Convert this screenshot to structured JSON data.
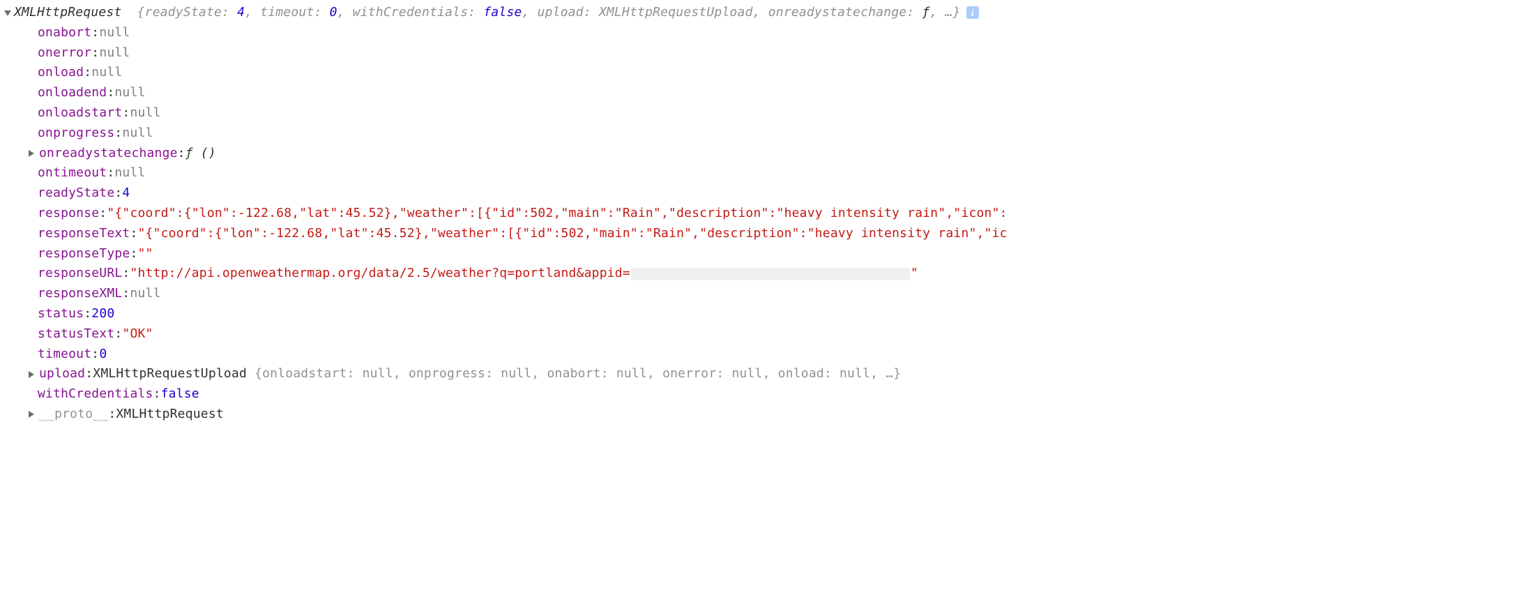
{
  "header": {
    "objectName": "XMLHttpRequest",
    "summaryParts": {
      "readyState_k": "readyState",
      "readyState_v": "4",
      "timeout_k": "timeout",
      "timeout_v": "0",
      "withCredentials_k": "withCredentials",
      "withCredentials_v": "false",
      "upload_k": "upload",
      "upload_v": "XMLHttpRequestUpload",
      "onready_k": "onreadystatechange",
      "onready_v": "ƒ",
      "ellipsis": "…"
    },
    "infoGlyph": "i"
  },
  "props": {
    "onabort_k": "onabort",
    "onabort_v": "null",
    "onerror_k": "onerror",
    "onerror_v": "null",
    "onload_k": "onload",
    "onload_v": "null",
    "onloadend_k": "onloadend",
    "onloadend_v": "null",
    "onloadstart_k": "onloadstart",
    "onloadstart_v": "null",
    "onprogress_k": "onprogress",
    "onprogress_v": "null",
    "onreadystatechange_k": "onreadystatechange",
    "onreadystatechange_v": "ƒ ()",
    "ontimeout_k": "ontimeout",
    "ontimeout_v": "null",
    "readyState_k": "readyState",
    "readyState_v": "4",
    "response_k": "response",
    "response_v": "\"{\"coord\":{\"lon\":-122.68,\"lat\":45.52},\"weather\":[{\"id\":502,\"main\":\"Rain\",\"description\":\"heavy intensity rain\",\"icon\":",
    "responseText_k": "responseText",
    "responseText_v": "\"{\"coord\":{\"lon\":-122.68,\"lat\":45.52},\"weather\":[{\"id\":502,\"main\":\"Rain\",\"description\":\"heavy intensity rain\",\"ic",
    "responseType_k": "responseType",
    "responseType_v": "\"\"",
    "responseURL_k": "responseURL",
    "responseURL_pre": "\"http://api.openweathermap.org/data/2.5/weather?q=portland&appid=",
    "responseURL_post": "\"",
    "responseXML_k": "responseXML",
    "responseXML_v": "null",
    "status_k": "status",
    "status_v": "200",
    "statusText_k": "statusText",
    "statusText_v": "\"OK\"",
    "timeout_k": "timeout",
    "timeout_v": "0",
    "upload_k": "upload",
    "upload_name": "XMLHttpRequestUpload",
    "upload_summary": {
      "onloadstart_k": "onloadstart",
      "onloadstart_v": "null",
      "onprogress_k": "onprogress",
      "onprogress_v": "null",
      "onabort_k": "onabort",
      "onabort_v": "null",
      "onerror_k": "onerror",
      "onerror_v": "null",
      "onload_k": "onload",
      "onload_v": "null",
      "ellipsis": "…"
    },
    "withCredentials_k": "withCredentials",
    "withCredentials_v": "false",
    "proto_k": "__proto__",
    "proto_v": "XMLHttpRequest"
  }
}
